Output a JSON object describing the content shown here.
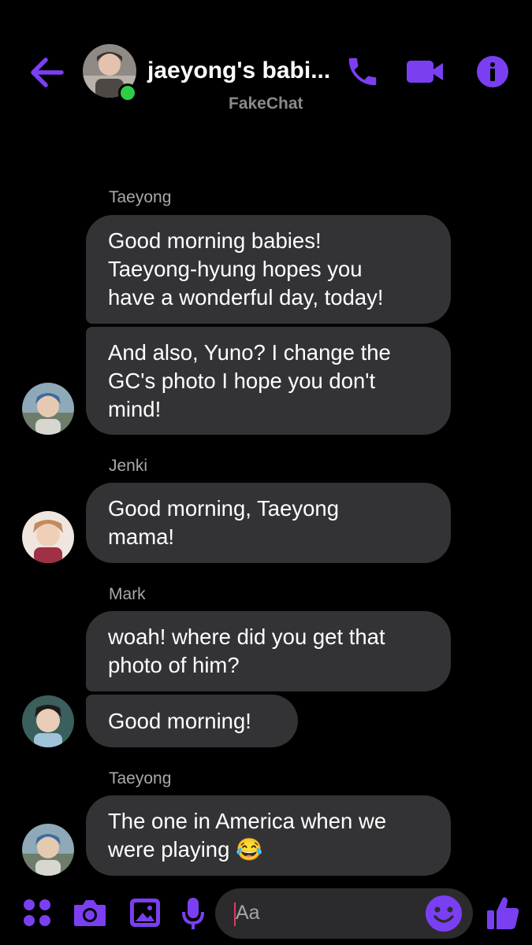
{
  "header": {
    "title": "jaeyong's babi...",
    "subtitle": "FakeChat",
    "accent": "#7b3ff2",
    "online_color": "#31cc46"
  },
  "messages": {
    "group1": {
      "sender": "Taeyong",
      "b1": [
        "Good morning babies!",
        "Taeyong-hyung hopes you",
        "have a wonderful day, today!"
      ],
      "b2": [
        "And also, Yuno?  I change the",
        "GC's photo I hope you don't",
        "mind!"
      ]
    },
    "group2": {
      "sender": "Jenki",
      "b1": [
        "Good morning, Taeyong",
        "mama!"
      ]
    },
    "group3": {
      "sender": "Mark",
      "b1": [
        "woah!  where did you get that",
        "photo of him?"
      ],
      "b2": [
        "Good morning!"
      ]
    },
    "group4": {
      "sender": "Taeyong",
      "b1": [
        "The one in America when we",
        "were playing 😂"
      ]
    }
  },
  "composer": {
    "placeholder": "Aa"
  },
  "icons": [
    "back-arrow-icon",
    "phone-icon",
    "video-camera-icon",
    "info-icon",
    "menu-dots-icon",
    "camera-icon",
    "gallery-icon",
    "microphone-icon",
    "emoji-icon",
    "thumbs-up-icon"
  ]
}
